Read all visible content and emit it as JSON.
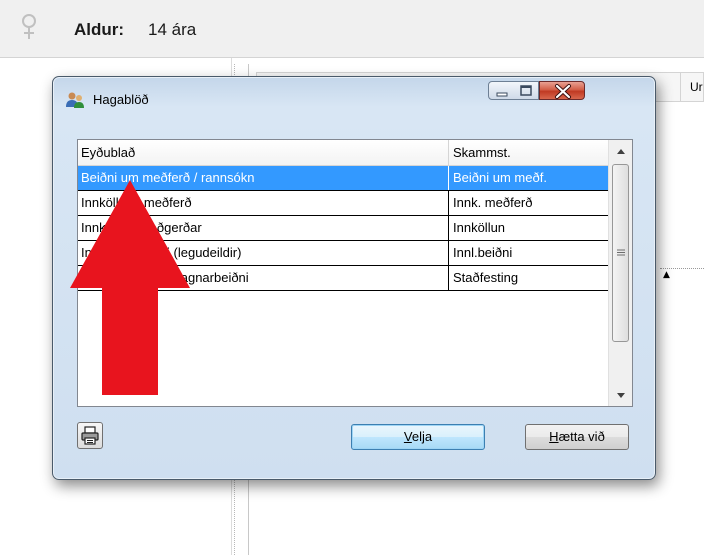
{
  "header": {
    "age_label": "Aldur:",
    "age_value": "14 ára",
    "gender_icon": "female-icon"
  },
  "background": {
    "right_header_text": "Ur"
  },
  "dialog": {
    "title": "Hagablöð",
    "title_icon": "users-icon",
    "columns": [
      "Eyðublað",
      "Skammst."
    ],
    "rows": [
      [
        "Beiðni um meðferð / rannsókn",
        "Beiðni um meðf."
      ],
      [
        "Innköllun í meðferð",
        "Innk. meðferð"
      ],
      [
        "Innköllun til aðgerðar",
        "Innköllun"
      ],
      [
        "Innlagnarbeiðni (legudeildir)",
        "Innl.beiðni"
      ],
      [
        "Staðfesting á innlagnarbeiðni",
        "Staðfesting"
      ]
    ],
    "selected_row_index": 0,
    "buttons": {
      "ok_underlined": "V",
      "ok_rest": "elja",
      "cancel_underlined": "H",
      "cancel_rest": "ætta við"
    }
  },
  "colors": {
    "selection": "#3399ff",
    "annotation_arrow": "#e8141e"
  }
}
